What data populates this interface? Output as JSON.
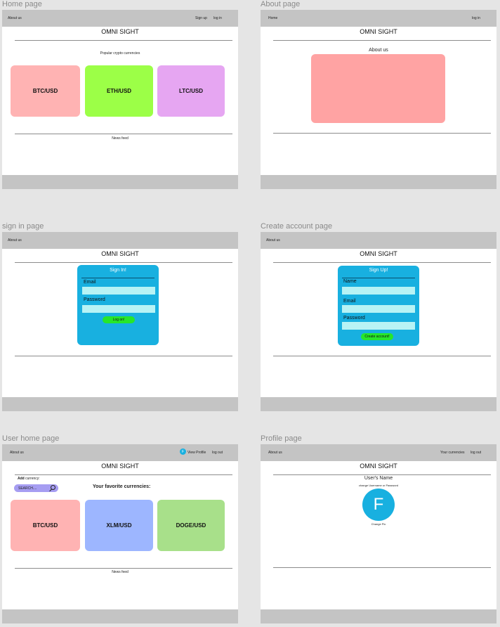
{
  "home": {
    "label": "Home page",
    "nav_about": "About us",
    "nav_signup": "Sign up",
    "nav_login": "log in",
    "brand": "OMNI SIGHT",
    "popular": "Popular crypto currencies",
    "cards": [
      "BTC/USD",
      "ETH/USD",
      "LTC/USD"
    ],
    "news": "News feed"
  },
  "about": {
    "label": "About page",
    "nav_home": "Home",
    "nav_login": "log in",
    "brand": "OMNI SIGHT",
    "heading": "About us"
  },
  "signin": {
    "label": "sign in page",
    "nav_about": "About us",
    "brand": "OMNI SIGHT",
    "title": "Sign In!",
    "email": "Email",
    "password": "Password",
    "button": "Log on!"
  },
  "create": {
    "label": "Create account page",
    "nav_about": "About us",
    "brand": "OMNI SIGHT",
    "title": "Sign Up!",
    "name": "Name",
    "email": "Email",
    "password": "Password",
    "button": "Create account!"
  },
  "userhome": {
    "label": "User home page",
    "nav_about": "About us",
    "avatar_letter": "F",
    "nav_view_profile": "View Profile",
    "nav_logout": "log out",
    "brand": "OMNI SIGHT",
    "add_bold": "Add",
    "add_rest": " currency:",
    "search_placeholder": "SEARCH....",
    "favorites": "Your favorite currencies:",
    "cards": [
      "BTC/USD",
      "XLM/USD",
      "DOGE/USD"
    ],
    "news": "News feed"
  },
  "profile": {
    "label": "Profile page",
    "nav_about": "About us",
    "nav_currencies": "Your currencies",
    "nav_logout": "log out",
    "brand": "OMNI SIGHT",
    "username": "User's Name",
    "change_creds": "change Username or Password",
    "avatar_letter": "F",
    "change_pic": "Change Pic"
  },
  "colors": {
    "card_red": "#ffb3b3",
    "card_green": "#9cff47",
    "card_purple": "#e6a6f2",
    "card_blue": "#9db6ff",
    "card_lightgreen": "#a8e08a",
    "about_box": "#ffa3a3",
    "form_blue": "#18b0e0"
  }
}
